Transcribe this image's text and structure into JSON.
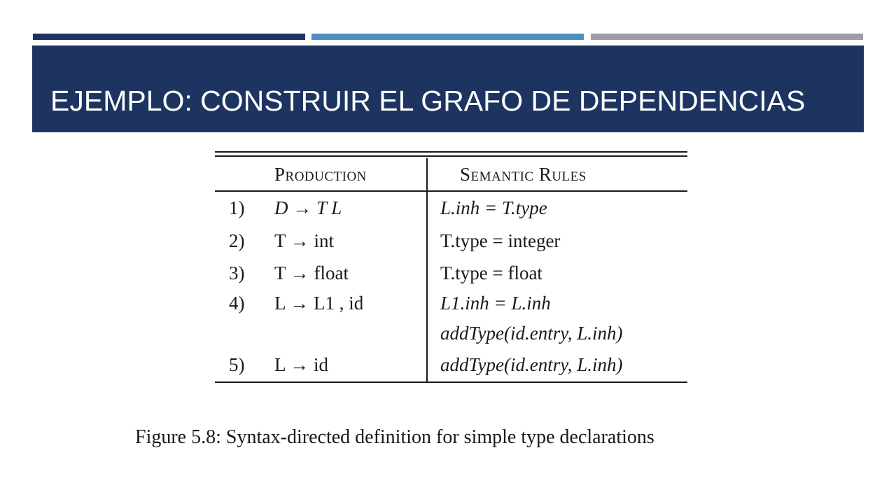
{
  "slide": {
    "title": "EJEMPLO: CONSTRUIR EL GRAFO DE DEPENDENCIAS",
    "accent_colors": [
      "#1d3461",
      "#4a8fc0",
      "#9aa0a6"
    ],
    "title_band_color": "#1d3461"
  },
  "table": {
    "headers": {
      "production": "Production",
      "semantic_rules": "Semantic  Rules"
    },
    "rows": [
      {
        "num": "1)",
        "production": "D → T L",
        "rule": "L.inh = T.type"
      },
      {
        "num": "2)",
        "production": "T → int",
        "rule": "T.type = integer"
      },
      {
        "num": "3)",
        "production": "T → float",
        "rule": "T.type = float"
      },
      {
        "num": "4)",
        "production": "L → L1 , id",
        "rule": "L1.inh = L.inh"
      },
      {
        "num": "",
        "production": "",
        "rule": "addType(id.entry, L.inh)"
      },
      {
        "num": "5)",
        "production": "L → id",
        "rule": "addType(id.entry, L.inh)"
      }
    ]
  },
  "caption": "Figure 5.8: Syntax-directed definition for simple type declarations"
}
